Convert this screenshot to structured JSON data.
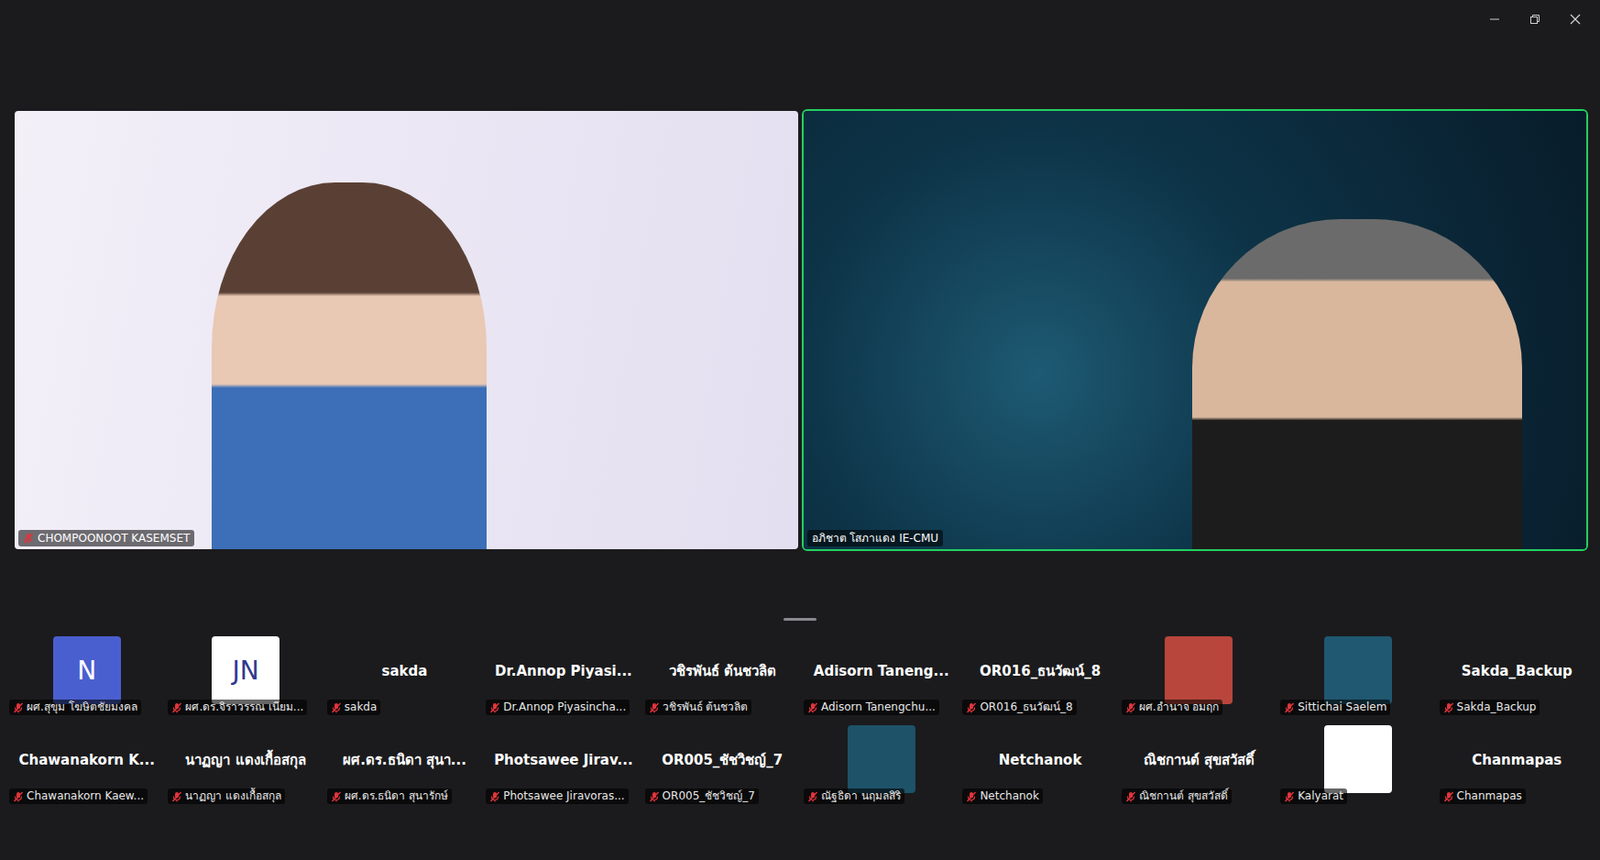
{
  "videos": [
    {
      "name": "CHOMPOONOOT KASEMSET",
      "muted": true,
      "active_speaker": false
    },
    {
      "name": "อภิชาต โสภาแดง IE-CMU",
      "muted": false,
      "active_speaker": true
    }
  ],
  "participants": [
    {
      "kind": "initials",
      "display": "N",
      "color": "#4a5fcf",
      "label": "ผศ.สุขุม โฆษิตชัยมงคล",
      "muted": true
    },
    {
      "kind": "initials",
      "display": "JN",
      "color": "#ffffff",
      "label": "ผศ.ดร.จิราวรรณ เนียม...",
      "muted": true
    },
    {
      "kind": "name",
      "display": "sakda",
      "label": "sakda",
      "muted": true
    },
    {
      "kind": "name",
      "display": "Dr.Annop Piyasi...",
      "label": "Dr.Annop Piyasincha...",
      "muted": true
    },
    {
      "kind": "name",
      "display": "วชิรพันธ์ ต้นชวลิต",
      "label": "วชิรพันธ์ ต้นชวลิต",
      "muted": true
    },
    {
      "kind": "name",
      "display": "Adisorn Taneng...",
      "label": "Adisorn Tanengchu...",
      "muted": true
    },
    {
      "kind": "name",
      "display": "OR016_ธนวัฒน์_8",
      "label": "OR016_ธนวัฒน์_8",
      "muted": true
    },
    {
      "kind": "photo",
      "color": "#b8463c",
      "label": "ผศ.อำนาจ อมฤก",
      "muted": true
    },
    {
      "kind": "photo",
      "color": "#1f5870",
      "label": "Sittichai Saelem",
      "muted": true
    },
    {
      "kind": "name",
      "display": "Sakda_Backup",
      "label": "Sakda_Backup",
      "muted": true
    },
    {
      "kind": "name",
      "display": "Chawanakorn K...",
      "label": "Chawanakorn Kaew...",
      "muted": true
    },
    {
      "kind": "name",
      "display": "นาฏญา แดงเกื้อสกุล",
      "label": "นาฏญา แดงเกื้อสกุล",
      "muted": true
    },
    {
      "kind": "name",
      "display": "ผศ.ดร.ธนิดา สุนา...",
      "label": "ผศ.ดร.ธนิดา สุนารักษ์",
      "muted": true
    },
    {
      "kind": "name",
      "display": "Photsawee Jirav...",
      "label": "Photsawee Jiravoras...",
      "muted": true
    },
    {
      "kind": "name",
      "display": "OR005_ชัชวิชญ์_7",
      "label": "OR005_ชัชวิชญ์_7",
      "muted": true
    },
    {
      "kind": "photo",
      "color": "#1d5268",
      "label": "ณัฐธิดา นฤมลสิริ",
      "muted": true
    },
    {
      "kind": "name",
      "display": "Netchanok",
      "label": "Netchanok",
      "muted": true
    },
    {
      "kind": "name",
      "display": "ณิชกานต์ สุขสวัสดิ์",
      "label": "ณิชกานต์ สุขสวัสดิ์",
      "muted": true
    },
    {
      "kind": "photo",
      "color": "#ffffff",
      "label": "Kalyarat",
      "muted": true
    },
    {
      "kind": "name",
      "display": "Chanmapas",
      "label": "Chanmapas",
      "muted": true
    }
  ]
}
